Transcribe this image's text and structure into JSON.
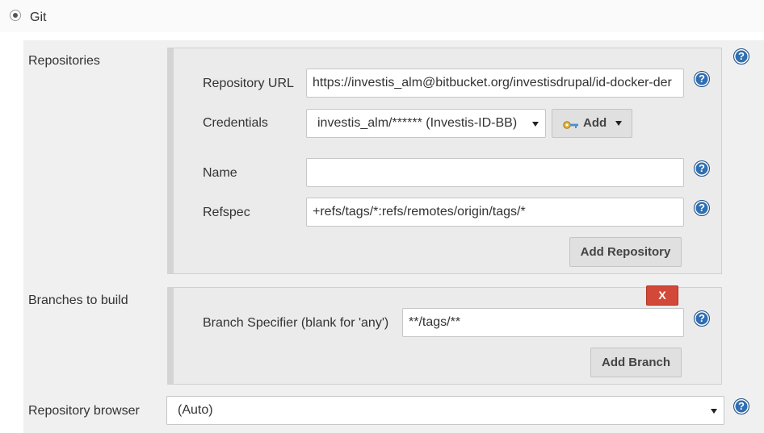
{
  "scm": {
    "selected_option": "Git"
  },
  "repositories": {
    "section_label": "Repositories",
    "url_label": "Repository URL",
    "url_value": "https://investis_alm@bitbucket.org/investisdrupal/id-docker-der",
    "credentials_label": "Credentials",
    "credentials_value": "investis_alm/****** (Investis-ID-BB)",
    "add_credentials_label": "Add",
    "name_label": "Name",
    "name_value": "",
    "refspec_label": "Refspec",
    "refspec_value": "+refs/tags/*:refs/remotes/origin/tags/*",
    "add_repository_label": "Add Repository"
  },
  "branches": {
    "section_label": "Branches to build",
    "delete_label": "X",
    "specifier_label": "Branch Specifier (blank for 'any')",
    "specifier_value": "**/tags/**",
    "add_branch_label": "Add Branch"
  },
  "browser": {
    "label": "Repository browser",
    "value": "(Auto)"
  },
  "help_glyph": "?",
  "colors": {
    "help_icon": "#2f6fb3",
    "delete_button": "#d24939",
    "panel_background": "#f0f0f0"
  }
}
